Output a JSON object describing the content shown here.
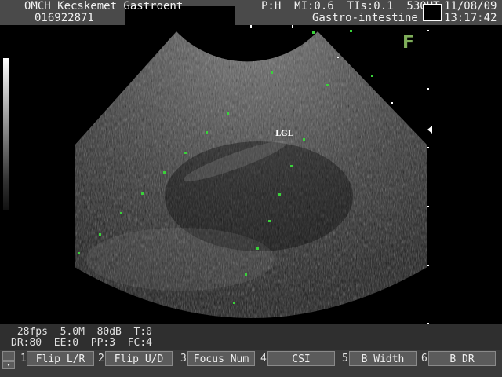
{
  "header": {
    "institution": "OMCH Kecskemet Gastroent",
    "patient_id": "016922871",
    "probe_params": "P:H  MI:0.6  TIs:0.1  530UT",
    "exam_preset": "Gastro-intestine",
    "date": "11/08/09",
    "time": "13:17:42"
  },
  "image": {
    "annotation": "LGL",
    "orientation_marker": "F"
  },
  "status": {
    "line1": " 28fps  5.0M  80dB  T:0",
    "line2": "DR:80  EE:0  PP:3  FC:4"
  },
  "softkeys": [
    {
      "num": "1",
      "label": "Flip L/R"
    },
    {
      "num": "2",
      "label": "Flip U/D"
    },
    {
      "num": "3",
      "label": "Focus Num"
    },
    {
      "num": "4",
      "label": "CSI"
    },
    {
      "num": "5",
      "label": "B Width"
    },
    {
      "num": "6",
      "label": "B DR"
    }
  ],
  "colors": {
    "header_bg": "#4a4a4a",
    "marker_green": "#7fae5a"
  }
}
